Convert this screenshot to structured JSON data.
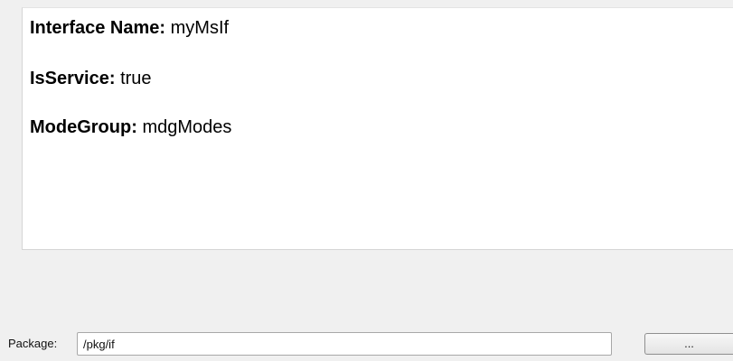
{
  "properties": {
    "interface_name": {
      "label": "Interface Name:",
      "value": "myMsIf"
    },
    "is_service": {
      "label": "IsService:",
      "value": "true"
    },
    "mode_group": {
      "label": "ModeGroup:",
      "value": "mdgModes"
    }
  },
  "package": {
    "label": "Package:",
    "value": "/pkg/if"
  },
  "browse_button": {
    "label": "..."
  }
}
